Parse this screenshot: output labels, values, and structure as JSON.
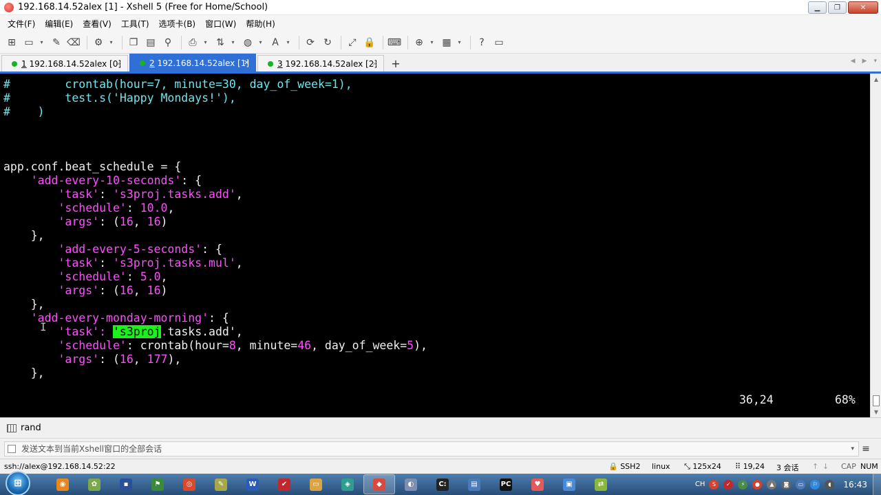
{
  "window": {
    "title": "192.168.14.52alex [1] - Xshell 5 (Free for Home/School)",
    "min_glyph": "▁",
    "max_glyph": "❐",
    "close_glyph": "✕"
  },
  "menu": [
    "文件(F)",
    "编辑(E)",
    "查看(V)",
    "工具(T)",
    "选项卡(B)",
    "窗口(W)",
    "帮助(H)"
  ],
  "toolbar_icons": {
    "new": "⊞",
    "open": "▭",
    "caret": "▾",
    "link": "✎",
    "disconnect": "⌫",
    "props": "⚙",
    "copy": "❐",
    "paste": "▤",
    "find": "⚲",
    "print": "⎙",
    "transfer": "⇅",
    "globe": "◍",
    "font": "A",
    "xftp": "⟳",
    "xmanager": "↻",
    "fullscreen": "⤢",
    "lock": "🔒",
    "keyboard": "⌨",
    "compose": "⊕",
    "layout": "▦",
    "help": "?",
    "chat": "▭"
  },
  "tabs": [
    {
      "num": "1",
      "label": "192.168.14.52alex [0]",
      "close": "×"
    },
    {
      "num": "2",
      "label": "192.168.14.52alex [1]",
      "close": "×"
    },
    {
      "num": "3",
      "label": "192.168.14.52alex [2]",
      "close": "×"
    }
  ],
  "tab_add_glyph": "+",
  "tab_nav": {
    "prev": "◀",
    "next": "▶",
    "menu": "▾"
  },
  "terminal": {
    "l1": [
      "#",
      "        crontab(hour=7, minute=30, day_of_week=1),"
    ],
    "l2": [
      "#",
      "        test.s('Happy Mondays!'),"
    ],
    "l3": [
      "#",
      "    )"
    ],
    "l4": "app.conf.beat_schedule = {",
    "l5": [
      "    ",
      "'add-every-10-seconds'",
      ": {"
    ],
    "l6": [
      "        ",
      "'task'",
      ": ",
      "'s3proj.tasks.add'",
      ","
    ],
    "l7": [
      "        ",
      "'schedule'",
      ": ",
      "10.0",
      ","
    ],
    "l8": [
      "        ",
      "'args'",
      ": (",
      "16",
      ", ",
      "16",
      ")"
    ],
    "l9": "    },",
    "l10": [
      "        ",
      "'add-every-5-seconds'",
      ": {"
    ],
    "l11": [
      "        ",
      "'task'",
      ": ",
      "'s3proj.tasks.mul'",
      ","
    ],
    "l12": [
      "        ",
      "'schedule'",
      ": ",
      "5.0",
      ","
    ],
    "l13": [
      "        ",
      "'args'",
      ": (",
      "16",
      ", ",
      "16",
      ")"
    ],
    "l14": "    },",
    "l15": [
      "    ",
      "'add-every-monday-morning'",
      ": {"
    ],
    "l16": [
      "        ",
      "'task'",
      ": ",
      "'s3proj",
      ".",
      "tasks.add'",
      ","
    ],
    "l17": [
      "        ",
      "'schedule'",
      ": crontab(hour=",
      "8",
      ", minute=",
      "46",
      ", day_of_week=",
      "5",
      "),"
    ],
    "l18": [
      "        ",
      "'args'",
      ": (",
      "16",
      ", ",
      "177",
      "),"
    ],
    "l19": "    },",
    "cursor_pos": "36,24",
    "percent": "68%"
  },
  "scrollbar": {
    "up": "▲",
    "down": "▼"
  },
  "ibeam": "I",
  "cmd_bar": {
    "label": "rand"
  },
  "send_bar": {
    "placeholder": "发送文本到当前Xshell窗口的全部会话",
    "dropdown": "▾",
    "menu": "≡"
  },
  "status": {
    "connection": "ssh://alex@192.168.14.52:22",
    "protocol": "SSH2",
    "term": "linux",
    "size": "125x24",
    "pos": "19,24",
    "sessions": "3 会话",
    "up": "↑",
    "down": "↓",
    "cap": "CAP",
    "num": "NUM"
  },
  "taskbar": {
    "start": "⊞",
    "apps": [
      {
        "name": "firefox",
        "glyph": "◉",
        "color": "#e8871e"
      },
      {
        "name": "paint",
        "glyph": "✿",
        "color": "#7aa84a"
      },
      {
        "name": "save",
        "glyph": "▪",
        "color": "#2b4f9a"
      },
      {
        "name": "tool",
        "glyph": "⚑",
        "color": "#3b8a3b"
      },
      {
        "name": "chrome",
        "glyph": "◎",
        "color": "#d84a2e"
      },
      {
        "name": "notepad",
        "glyph": "✎",
        "color": "#a8a84a"
      },
      {
        "name": "word",
        "glyph": "W",
        "color": "#2b5bb8"
      },
      {
        "name": "vpn",
        "glyph": "✔",
        "color": "#c0292b"
      },
      {
        "name": "explorer",
        "glyph": "▭",
        "color": "#d9a441"
      },
      {
        "name": "app",
        "glyph": "◈",
        "color": "#2e9e8e"
      },
      {
        "name": "xshell",
        "glyph": "◆",
        "color": "#d84a3e"
      },
      {
        "name": "disk",
        "glyph": "◐",
        "color": "#7d8fb0"
      },
      {
        "name": "cmd",
        "glyph": "C:",
        "color": "#222222"
      },
      {
        "name": "window",
        "glyph": "▤",
        "color": "#4a7ab8"
      },
      {
        "name": "pycharm",
        "glyph": "PC",
        "color": "#111111"
      },
      {
        "name": "heart",
        "glyph": "♥",
        "color": "#e25a5a"
      },
      {
        "name": "remote",
        "glyph": "▣",
        "color": "#4a8ad8"
      },
      {
        "name": "xftp",
        "glyph": "⇄",
        "color": "#8ab83a"
      }
    ],
    "tray": {
      "lang": "CH",
      "items": [
        {
          "name": "s",
          "glyph": "S",
          "color": "#d8402e"
        },
        {
          "name": "v",
          "glyph": "✓",
          "color": "#c0292b"
        },
        {
          "name": "net",
          "glyph": "⚡",
          "color": "#4a8a4a"
        },
        {
          "name": "rec",
          "glyph": "●",
          "color": "#d8402e"
        },
        {
          "name": "lock",
          "glyph": "▲",
          "color": "#777777"
        },
        {
          "name": "cam",
          "glyph": "◙",
          "color": "#666666"
        },
        {
          "name": "monitor",
          "glyph": "▭",
          "color": "#4a7ab8"
        },
        {
          "name": "flag",
          "glyph": "⚐",
          "color": "#2e8ae0"
        },
        {
          "name": "volume",
          "glyph": "◖",
          "color": "#555555"
        }
      ],
      "clock": "16:43"
    }
  }
}
